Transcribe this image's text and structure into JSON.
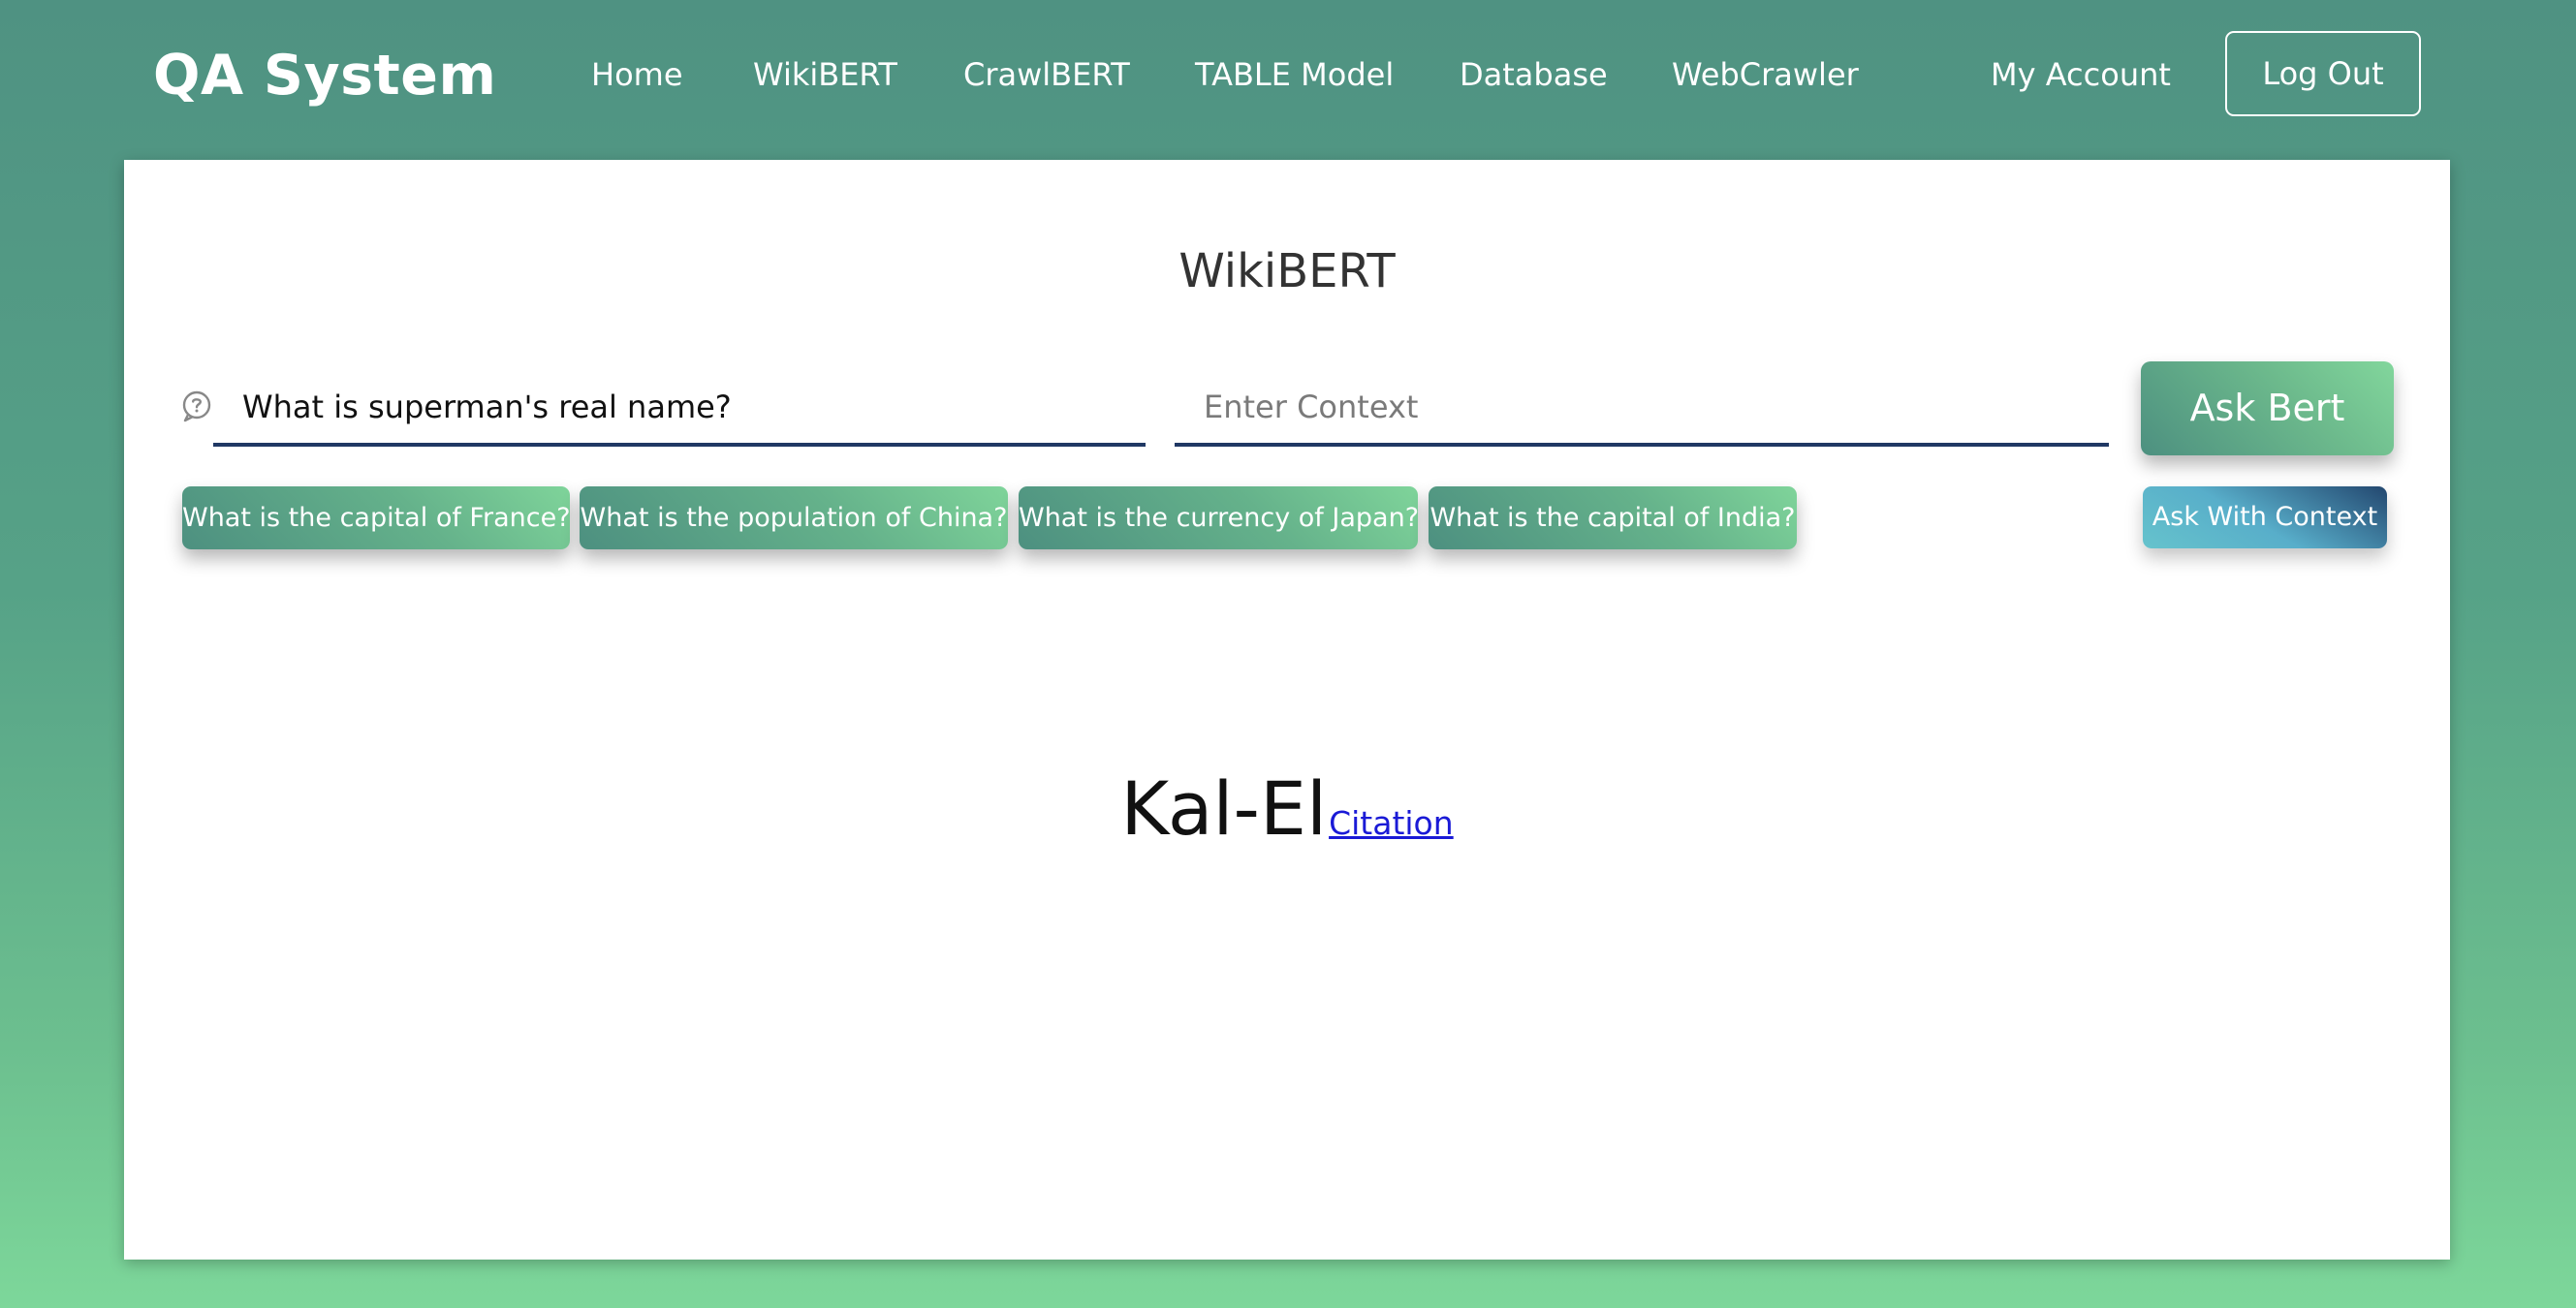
{
  "app": {
    "brand": "QA System"
  },
  "nav": {
    "links": [
      {
        "label": "Home"
      },
      {
        "label": "WikiBERT"
      },
      {
        "label": "CrawlBERT"
      },
      {
        "label": "TABLE Model"
      },
      {
        "label": "Database"
      },
      {
        "label": "WebCrawler"
      }
    ],
    "account_label": "My Account",
    "logout_label": "Log Out"
  },
  "main": {
    "title": "WikiBERT",
    "question": {
      "value": "What is superman's real name?",
      "icon": "question-bubble-icon"
    },
    "context": {
      "value": "",
      "placeholder": "Enter Context"
    },
    "ask_label": "Ask Bert",
    "ask_context_label": "Ask With Context",
    "suggestions": [
      {
        "label": "What is the capital of France?"
      },
      {
        "label": "What is the population of China?"
      },
      {
        "label": "What is the currency of Japan?"
      },
      {
        "label": "What is the capital of India?"
      }
    ],
    "answer": {
      "text": "Kal-El",
      "citation_label": "Citation"
    }
  },
  "colors": {
    "background_top": "#4f9282",
    "background_bottom": "#7dd79a",
    "input_underline": "#203864",
    "citation_link": "#1a1ad6",
    "context_button_dark": "#23476f"
  }
}
